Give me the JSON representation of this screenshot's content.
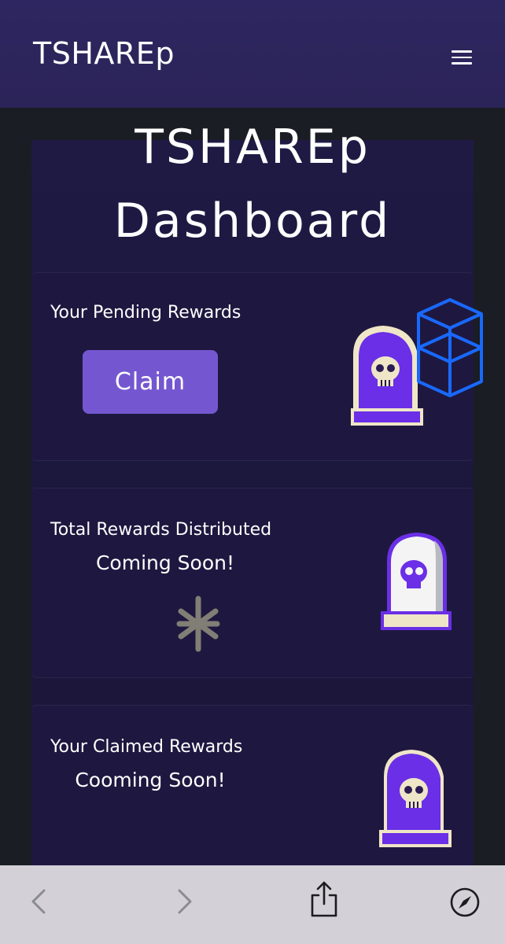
{
  "header": {
    "brand": "TSHAREp",
    "menu_icon": "hamburger-menu-icon"
  },
  "page": {
    "title_line1": "TSHAREp",
    "title_line2": "Dashboard"
  },
  "cards": {
    "pending": {
      "label": "Your Pending Rewards",
      "button": "Claim",
      "icons": [
        "tombstone-skull-icon",
        "fantom-logo-icon"
      ]
    },
    "distributed": {
      "label": "Total Rewards Distributed",
      "status": "Coming Soon!",
      "icons": [
        "tombstone-skull-icon",
        "sparkle-icon"
      ]
    },
    "claimed": {
      "label": "Your Claimed Rewards",
      "status": "Cooming Soon!",
      "icons": [
        "tombstone-skull-icon"
      ]
    }
  },
  "browser_toolbar": {
    "icons": [
      "back-icon",
      "forward-icon",
      "share-icon",
      "compass-icon"
    ]
  },
  "colors": {
    "header_bg": "#2e2660",
    "panel_bg": "#1e1840",
    "claim_button": "#7457d0",
    "tombstone_purple": "#6a2fe6",
    "fantom_blue": "#1969ff",
    "toolbar_bg": "#d3d0d8"
  }
}
